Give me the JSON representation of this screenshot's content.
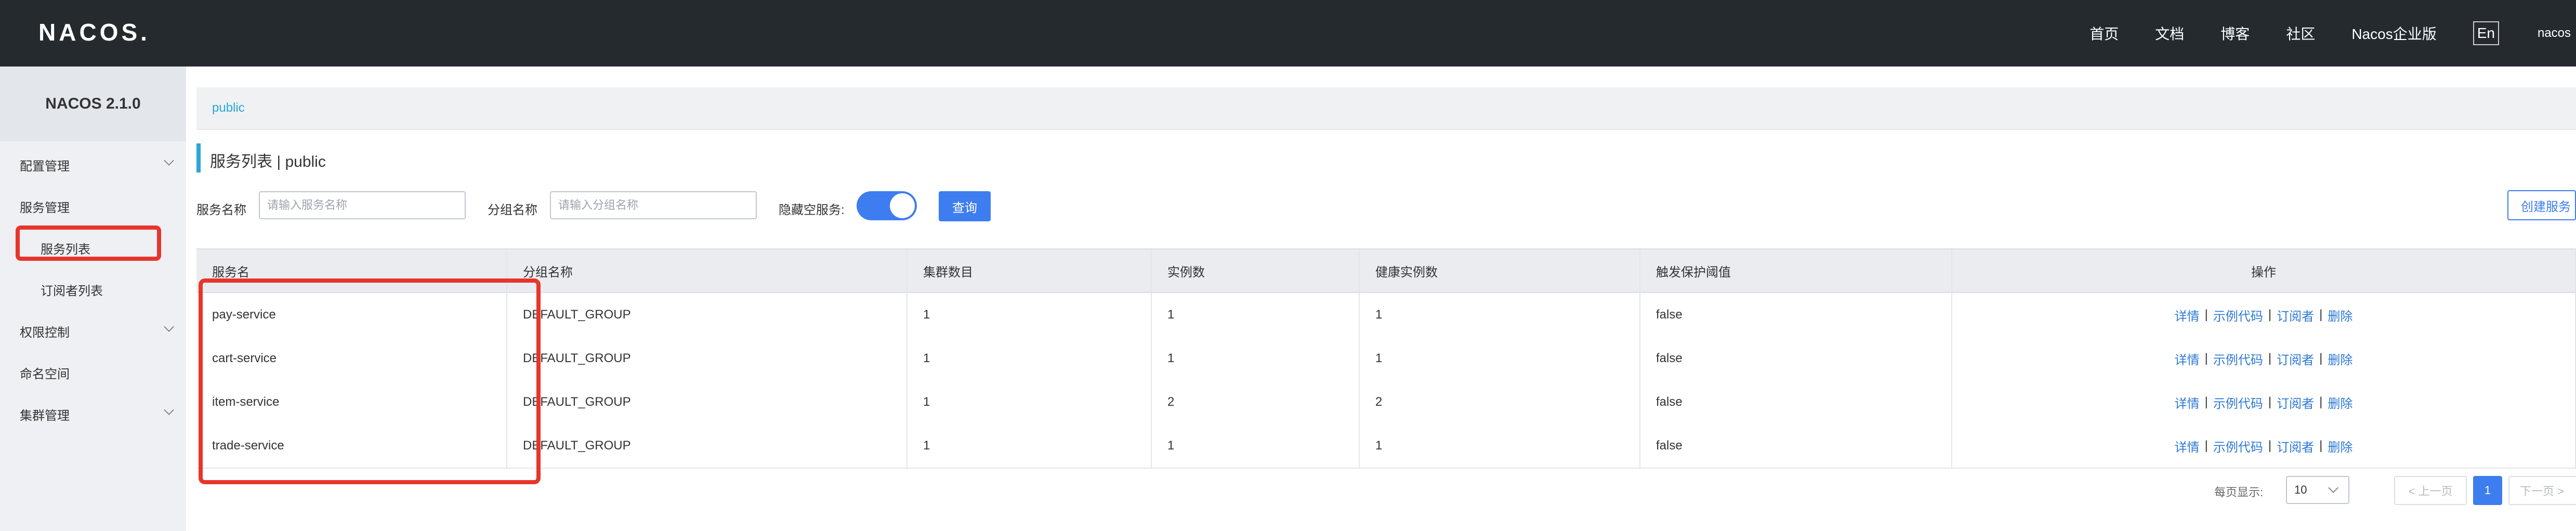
{
  "header": {
    "logo_text": "NACOS.",
    "nav": [
      "首页",
      "文档",
      "博客",
      "社区",
      "Nacos企业版"
    ],
    "lang": "En",
    "user": "nacos"
  },
  "sidebar": {
    "version": "NACOS 2.1.0",
    "menu": [
      {
        "label": "配置管理"
      },
      {
        "label": "服务管理"
      },
      {
        "label": "权限控制"
      },
      {
        "label": "命名空间"
      },
      {
        "label": "集群管理"
      }
    ],
    "submenu": [
      "服务列表",
      "订阅者列表"
    ]
  },
  "breadcrumb": "public",
  "page_title": "服务列表  |  public",
  "filters": {
    "service_name_label": "服务名称",
    "service_name_placeholder": "请输入服务名称",
    "group_name_label": "分组名称",
    "group_name_placeholder": "请输入分组名称",
    "hide_empty_label": "隐藏空服务:",
    "hide_empty_on": true,
    "query_button": "查询",
    "create_button": "创建服务"
  },
  "table": {
    "columns": [
      "服务名",
      "分组名称",
      "集群数目",
      "实例数",
      "健康实例数",
      "触发保护阈值",
      "操作"
    ],
    "rows": [
      {
        "name": "pay-service",
        "group": "DEFAULT_GROUP",
        "clusters": "1",
        "instances": "1",
        "healthy": "1",
        "protect": "false"
      },
      {
        "name": "cart-service",
        "group": "DEFAULT_GROUP",
        "clusters": "1",
        "instances": "1",
        "healthy": "1",
        "protect": "false"
      },
      {
        "name": "item-service",
        "group": "DEFAULT_GROUP",
        "clusters": "1",
        "instances": "2",
        "healthy": "2",
        "protect": "false"
      },
      {
        "name": "trade-service",
        "group": "DEFAULT_GROUP",
        "clusters": "1",
        "instances": "1",
        "healthy": "1",
        "protect": "false"
      }
    ],
    "actions": [
      "详情",
      "示例代码",
      "订阅者",
      "删除"
    ]
  },
  "pagination": {
    "per_page_label": "每页显示:",
    "per_page": "10",
    "prev": "< 上一页",
    "current": "1",
    "next": "下一页 >"
  },
  "colors": {
    "accent": "#3e7df0",
    "highlight": "#e8352b",
    "header_bg": "#252a2f"
  }
}
